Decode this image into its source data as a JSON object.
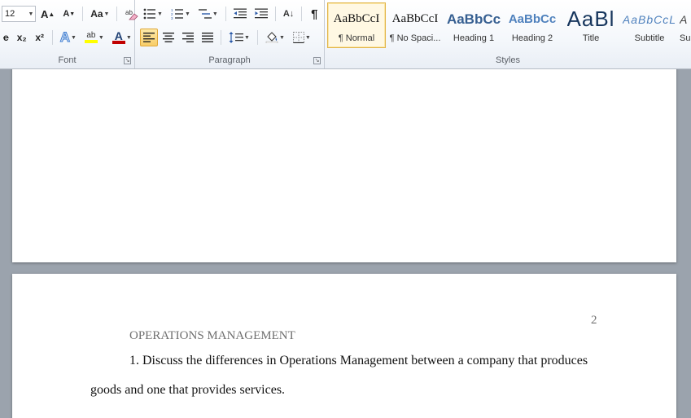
{
  "font_group": {
    "label": "Font",
    "font_size": "12",
    "grow_label": "A",
    "shrink_label": "A",
    "change_case_label": "Aa",
    "strike_label": "abe",
    "subscript_label": "x₂",
    "superscript_label": "x²",
    "text_effects_label": "A",
    "highlight_label": "ab",
    "font_color_label": "A",
    "clear_format_label": "ABC"
  },
  "paragraph_group": {
    "label": "Paragraph",
    "sort_label": "A↓",
    "show_marks_label": "¶"
  },
  "styles_group": {
    "label": "Styles",
    "items": [
      {
        "sample": "AaBbCcI",
        "name": "¶ Normal"
      },
      {
        "sample": "AaBbCcI",
        "name": "¶ No Spaci..."
      },
      {
        "sample": "AaBbCc",
        "name": "Heading 1"
      },
      {
        "sample": "AaBbCc",
        "name": "Heading 2"
      },
      {
        "sample": "AaBl",
        "name": "Title"
      },
      {
        "sample": "AaBbCcL",
        "name": "Subtitle"
      },
      {
        "sample": "A",
        "name": "Su"
      }
    ]
  },
  "colors": {
    "accent_selected": "#f8cd68",
    "heading_blue": "#365f91",
    "highlight_yellow": "#ffff00",
    "font_red": "#c00000"
  },
  "document": {
    "page_number": "2",
    "running_head": "OPERATIONS MANAGEMENT",
    "line1": "1. Discuss the differences in Operations Management between a company that produces",
    "line2": "goods and one that provides services."
  }
}
